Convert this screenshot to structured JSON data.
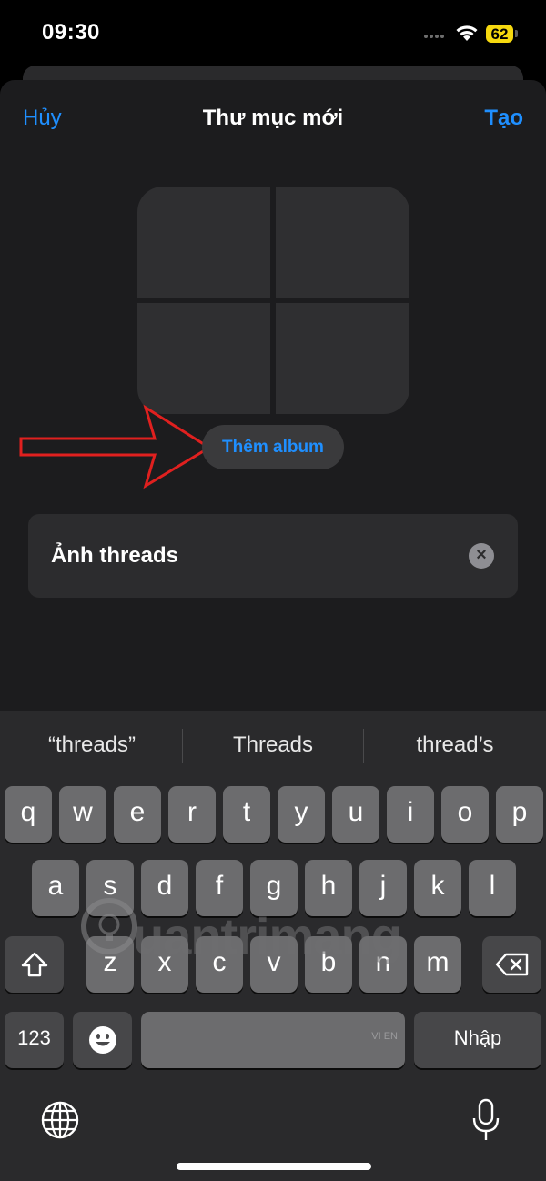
{
  "status": {
    "time": "09:30",
    "battery": "62"
  },
  "nav": {
    "cancel": "Hủy",
    "title": "Thư mục mới",
    "create": "Tạo"
  },
  "add_album_label": "Thêm album",
  "name_field": {
    "value": "Ảnh threads"
  },
  "suggestions": [
    "“threads”",
    "Threads",
    "thread’s"
  ],
  "keyboard": {
    "row1": [
      "q",
      "w",
      "e",
      "r",
      "t",
      "y",
      "u",
      "i",
      "o",
      "p"
    ],
    "row2": [
      "a",
      "s",
      "d",
      "f",
      "g",
      "h",
      "j",
      "k",
      "l"
    ],
    "row3": [
      "z",
      "x",
      "c",
      "v",
      "b",
      "n",
      "m"
    ],
    "numbers_key": "123",
    "space_lang": "VI EN",
    "return_key": "Nhập"
  },
  "watermark": "uantrimang",
  "colors": {
    "accent": "#1f8fff",
    "battery": "#f6d90f",
    "annotation_arrow": "#e0201f"
  }
}
